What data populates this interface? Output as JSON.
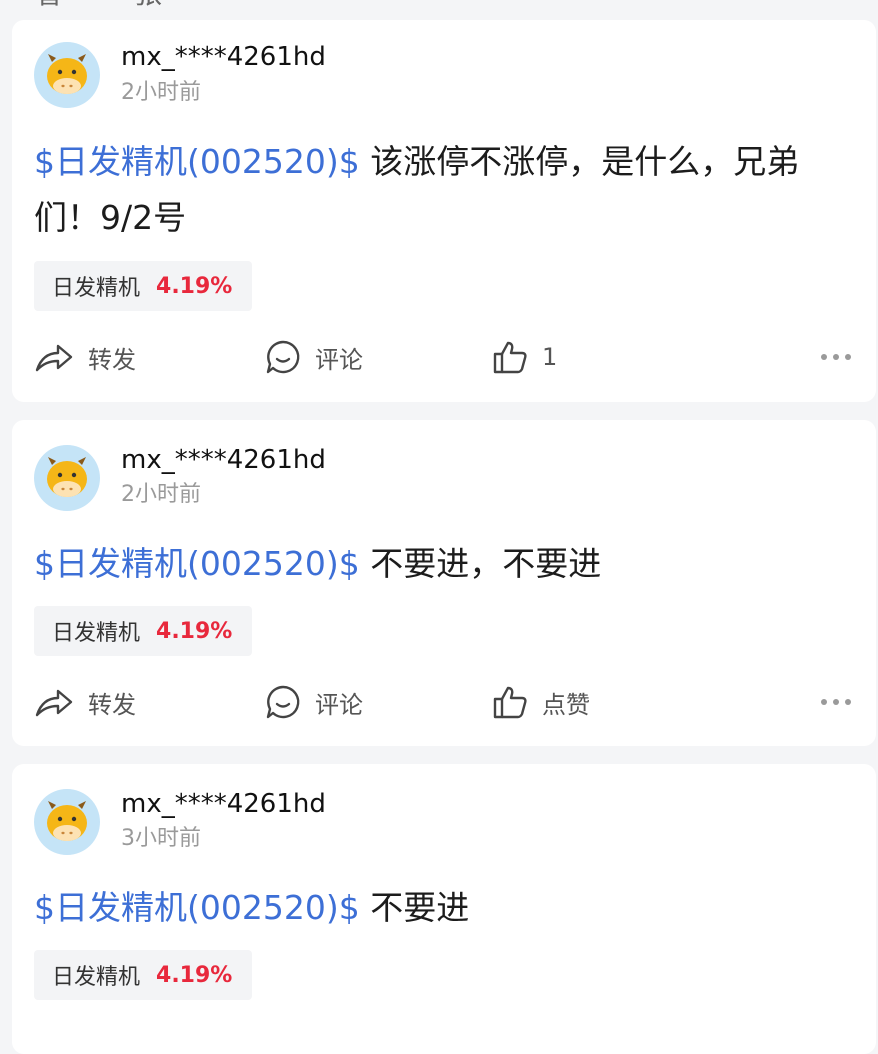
{
  "top_fragment": "看一张",
  "posts": [
    {
      "username": "mx_****4261hd",
      "time": "2小时前",
      "stock_link": "$日发精机(002520)$",
      "text": " 该涨停不涨停，是什么，兄弟们！9/2号",
      "tag_name": "日发精机",
      "tag_change": "4.19%",
      "forward_label": "转发",
      "comment_label": "评论",
      "like_label": "1"
    },
    {
      "username": "mx_****4261hd",
      "time": "2小时前",
      "stock_link": "$日发精机(002520)$",
      "text": " 不要进，不要进",
      "tag_name": "日发精机",
      "tag_change": "4.19%",
      "forward_label": "转发",
      "comment_label": "评论",
      "like_label": "点赞"
    },
    {
      "username": "mx_****4261hd",
      "time": "3小时前",
      "stock_link": "$日发精机(002520)$",
      "text": " 不要进",
      "tag_name": "日发精机",
      "tag_change": "4.19%"
    }
  ],
  "colors": {
    "stock_link": "#3d6fd6",
    "rise": "#e8283c",
    "avatar_bg": "#c5e4f7",
    "avatar_face": "#f5b617"
  },
  "icons": {
    "forward": "share-arrow-icon",
    "comment": "chat-bubble-icon",
    "like": "thumbs-up-icon",
    "more": "more-dots-icon",
    "avatar": "cow-avatar-icon"
  }
}
